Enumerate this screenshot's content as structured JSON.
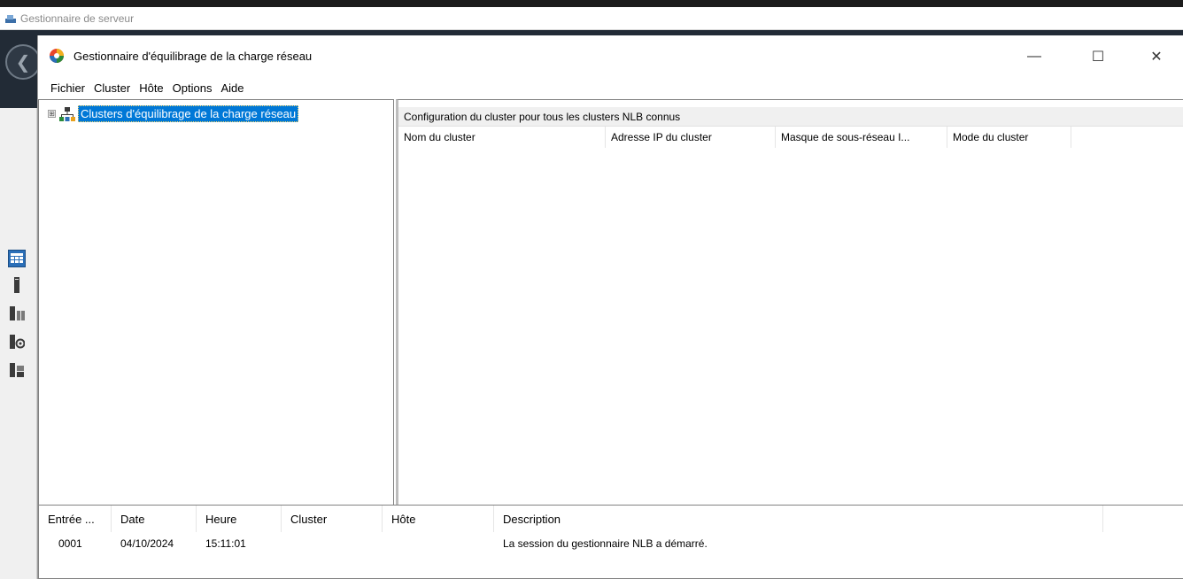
{
  "server_manager": {
    "title": "Gestionnaire de serveur"
  },
  "nlb_window": {
    "title": "Gestionnaire d'équilibrage de la charge réseau",
    "menu": [
      "Fichier",
      "Cluster",
      "Hôte",
      "Options",
      "Aide"
    ],
    "tree_root_label": "Clusters d'équilibrage de la charge réseau",
    "tree_expander": "⊞",
    "config_header": "Configuration du cluster pour tous les clusters NLB connus",
    "cluster_columns": [
      "Nom du cluster",
      "Adresse IP du cluster",
      "Masque de sous-réseau I...",
      "Mode du cluster"
    ],
    "log_columns": [
      "Entrée ...",
      "Date",
      "Heure",
      "Cluster",
      "Hôte",
      "Description"
    ],
    "log_rows": [
      {
        "entry": "0001",
        "date": "04/10/2024",
        "time": "15:11:01",
        "cluster": "",
        "host": "",
        "description": "La session du gestionnaire NLB a démarré."
      }
    ]
  },
  "icons": {
    "back": "back-arrow-icon",
    "dashboard": "dashboard-icon",
    "local_server": "server-icon",
    "all_servers": "servers-icon",
    "ad_ds": "directory-icon",
    "file_services": "file-services-icon",
    "nlb_app": "nlb-app-icon",
    "cluster": "cluster-network-icon"
  },
  "colors": {
    "selection": "#0078d7",
    "header_band": "#222b36",
    "dashboard_icon": "#2b6fb8"
  }
}
